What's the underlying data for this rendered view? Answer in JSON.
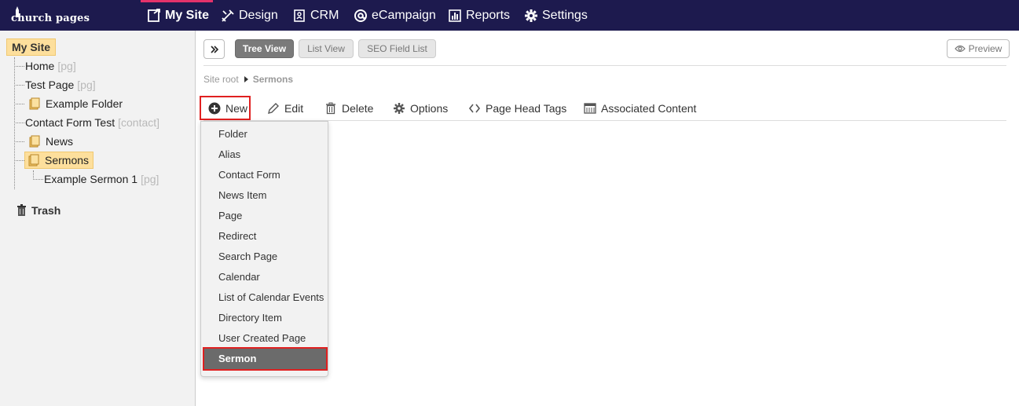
{
  "app": {
    "logo_text": "church pages"
  },
  "topnav": {
    "items": [
      {
        "label": "My Site",
        "icon": "site-icon"
      },
      {
        "label": "Design",
        "icon": "design-icon"
      },
      {
        "label": "CRM",
        "icon": "crm-icon"
      },
      {
        "label": "eCampaign",
        "icon": "at-icon"
      },
      {
        "label": "Reports",
        "icon": "reports-icon"
      },
      {
        "label": "Settings",
        "icon": "gear-icon"
      }
    ],
    "active": "My Site"
  },
  "sidebar": {
    "root": "My Site",
    "nodes": [
      {
        "label": "Home",
        "tag": "[pg]"
      },
      {
        "label": "Test Page",
        "tag": "[pg]"
      },
      {
        "label": "Example Folder",
        "tag": ""
      },
      {
        "label": "Contact Form Test",
        "tag": "[contact]"
      },
      {
        "label": "News",
        "tag": ""
      },
      {
        "label": "Sermons",
        "tag": ""
      },
      {
        "label": "Example Sermon 1",
        "tag": "[pg]"
      }
    ],
    "trash": "Trash"
  },
  "view_tabs": {
    "tree": "Tree View",
    "list": "List View",
    "seo": "SEO Field List",
    "preview": "Preview"
  },
  "breadcrumb": {
    "root": "Site root",
    "current": "Sermons"
  },
  "toolbar": {
    "new": "New",
    "edit": "Edit",
    "delete": "Delete",
    "options": "Options",
    "head_tags": "Page Head Tags",
    "associated": "Associated Content"
  },
  "new_menu": {
    "items": [
      "Folder",
      "Alias",
      "Contact Form",
      "News Item",
      "Page",
      "Redirect",
      "Search Page",
      "Calendar",
      "List of Calendar Events",
      "Directory Item",
      "User Created Page",
      "Sermon"
    ],
    "highlighted": "Sermon"
  },
  "colors": {
    "topbar": "#1d1a4e",
    "active_accent": "#e4326a",
    "selection": "#fddf9c",
    "annotation_red": "#e02020"
  }
}
